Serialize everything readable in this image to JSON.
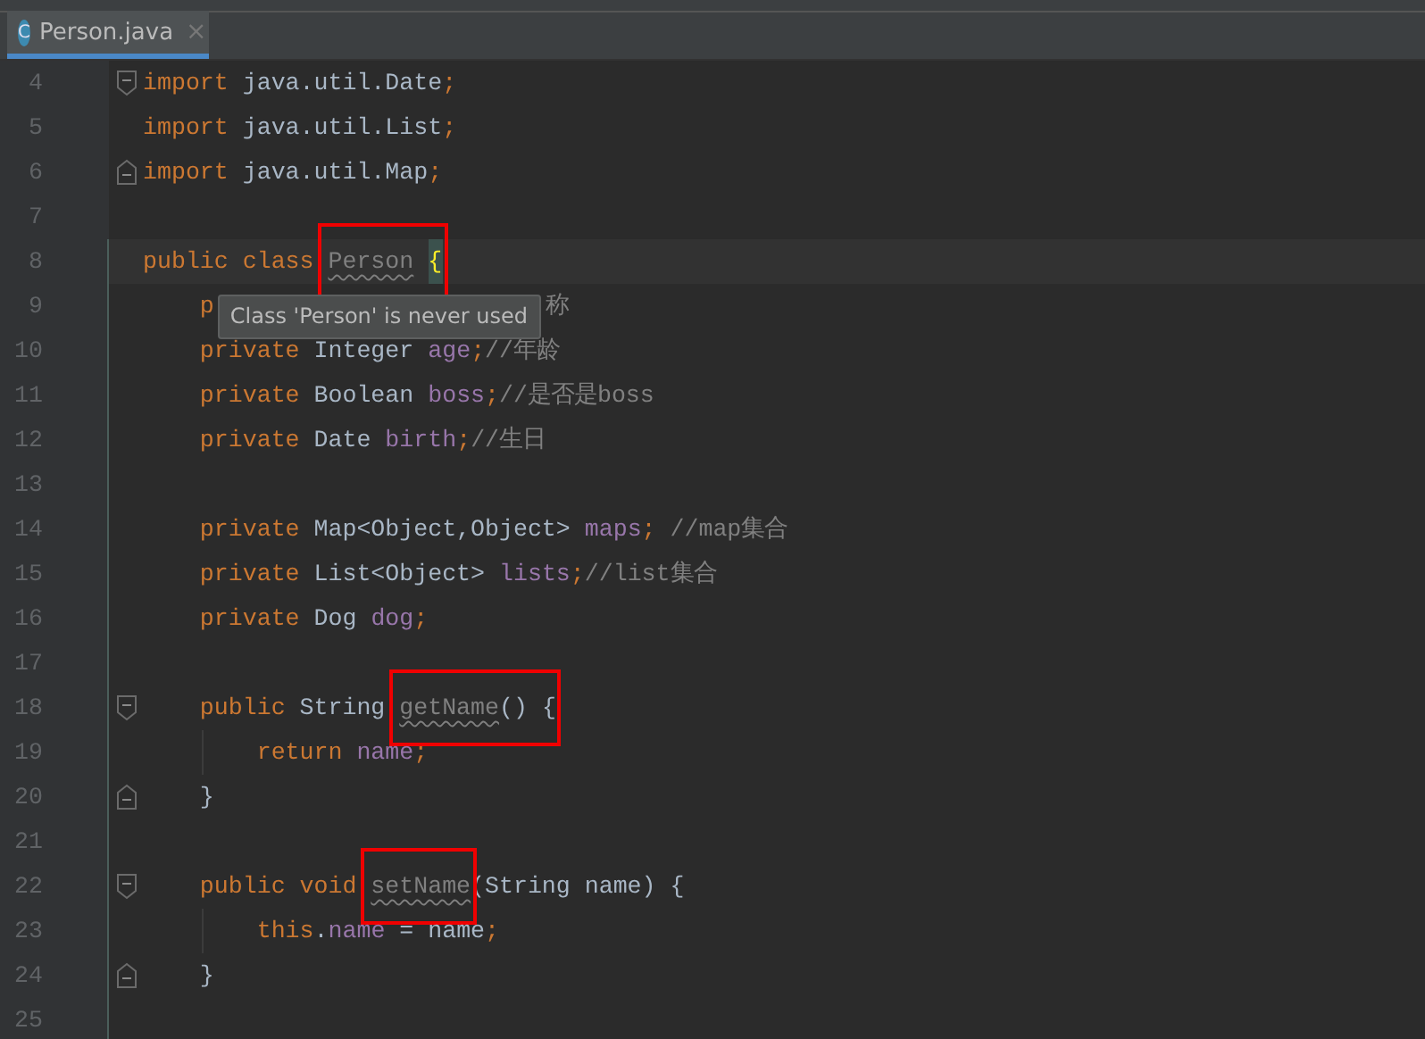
{
  "tabs": [
    {
      "label": "Person.java",
      "icon": "C",
      "selected": true,
      "close": "×"
    }
  ],
  "lines": [
    {
      "number": "4",
      "fold_start": true,
      "tokens": [
        {
          "text": "import ",
          "kind": "keyword"
        },
        {
          "text": "java.util.Date",
          "kind": "plain"
        },
        {
          "text": ";",
          "kind": "punct"
        }
      ]
    },
    {
      "number": "5",
      "tokens": [
        {
          "text": "import ",
          "kind": "keyword"
        },
        {
          "text": "java.util.List",
          "kind": "plain"
        },
        {
          "text": ";",
          "kind": "punct"
        }
      ]
    },
    {
      "number": "6",
      "fold_end": true,
      "tokens": [
        {
          "text": "import ",
          "kind": "keyword"
        },
        {
          "text": "java.util.Map",
          "kind": "plain"
        },
        {
          "text": ";",
          "kind": "punct"
        }
      ]
    },
    {
      "number": "7"
    },
    {
      "number": "8",
      "current": true,
      "tokens": [
        {
          "text": "public class ",
          "kind": "keyword"
        },
        {
          "text": "Person",
          "kind": "unused",
          "boxed": true
        },
        {
          "text": "{",
          "kind": "brace_match",
          "boxed": true
        }
      ]
    },
    {
      "number": "9",
      "tokens": [
        {
          "text": "    p",
          "kind": "keyword"
        },
        {
          "text": "Class 'Person' is never used",
          "kind": "tooltip"
        },
        {
          "text": "称",
          "kind": "comment"
        }
      ]
    },
    {
      "number": "10",
      "tokens": [
        {
          "text": "    private ",
          "kind": "keyword"
        },
        {
          "text": "Integer ",
          "kind": "plain"
        },
        {
          "text": "age",
          "kind": "field"
        },
        {
          "text": ";",
          "kind": "punct"
        },
        {
          "text": "//年龄",
          "kind": "comment"
        }
      ]
    },
    {
      "number": "11",
      "tokens": [
        {
          "text": "    private ",
          "kind": "keyword"
        },
        {
          "text": "Boolean ",
          "kind": "plain"
        },
        {
          "text": "boss",
          "kind": "field"
        },
        {
          "text": ";",
          "kind": "punct"
        },
        {
          "text": "//是否是boss",
          "kind": "comment"
        }
      ]
    },
    {
      "number": "12",
      "tokens": [
        {
          "text": "    private ",
          "kind": "keyword"
        },
        {
          "text": "Date ",
          "kind": "plain"
        },
        {
          "text": "birth",
          "kind": "field"
        },
        {
          "text": ";",
          "kind": "punct"
        },
        {
          "text": "//生日",
          "kind": "comment"
        }
      ]
    },
    {
      "number": "13"
    },
    {
      "number": "14",
      "tokens": [
        {
          "text": "    private ",
          "kind": "keyword"
        },
        {
          "text": "Map<Object,Object> ",
          "kind": "plain"
        },
        {
          "text": "maps",
          "kind": "field"
        },
        {
          "text": "; ",
          "kind": "punct"
        },
        {
          "text": "//map集合",
          "kind": "comment"
        }
      ]
    },
    {
      "number": "15",
      "tokens": [
        {
          "text": "    private ",
          "kind": "keyword"
        },
        {
          "text": "List<Object> ",
          "kind": "plain"
        },
        {
          "text": "lists",
          "kind": "field"
        },
        {
          "text": ";",
          "kind": "punct"
        },
        {
          "text": "//list集合",
          "kind": "comment"
        }
      ]
    },
    {
      "number": "16",
      "tokens": [
        {
          "text": "    private ",
          "kind": "keyword"
        },
        {
          "text": "Dog ",
          "kind": "plain"
        },
        {
          "text": "dog",
          "kind": "field"
        },
        {
          "text": ";",
          "kind": "punct"
        }
      ]
    },
    {
      "number": "17"
    },
    {
      "number": "18",
      "fold_start": true,
      "tokens": [
        {
          "text": "    public ",
          "kind": "keyword"
        },
        {
          "text": "String ",
          "kind": "plain"
        },
        {
          "text": "getName",
          "kind": "unused",
          "boxed": true
        },
        {
          "text": "() {",
          "kind": "plain",
          "boxed": true
        }
      ]
    },
    {
      "number": "19",
      "guide": true,
      "tokens": [
        {
          "text": "        return ",
          "kind": "keyword"
        },
        {
          "text": "name",
          "kind": "field"
        },
        {
          "text": ";",
          "kind": "punct"
        }
      ]
    },
    {
      "number": "20",
      "fold_end": true,
      "tokens": [
        {
          "text": "    }",
          "kind": "plain"
        }
      ]
    },
    {
      "number": "21"
    },
    {
      "number": "22",
      "fold_start": true,
      "tokens": [
        {
          "text": "    public void ",
          "kind": "keyword"
        },
        {
          "text": "setName",
          "kind": "unused",
          "boxed": true
        },
        {
          "text": "(String name) {",
          "kind": "plain"
        }
      ]
    },
    {
      "number": "23",
      "guide": true,
      "tokens": [
        {
          "text": "        this",
          "kind": "keyword"
        },
        {
          "text": ".",
          "kind": "plain"
        },
        {
          "text": "name",
          "kind": "field"
        },
        {
          "text": " = name",
          "kind": "plain"
        },
        {
          "text": ";",
          "kind": "punct"
        }
      ]
    },
    {
      "number": "24",
      "fold_end": true,
      "tokens": [
        {
          "text": "    }",
          "kind": "plain"
        }
      ]
    },
    {
      "number": "25"
    }
  ]
}
